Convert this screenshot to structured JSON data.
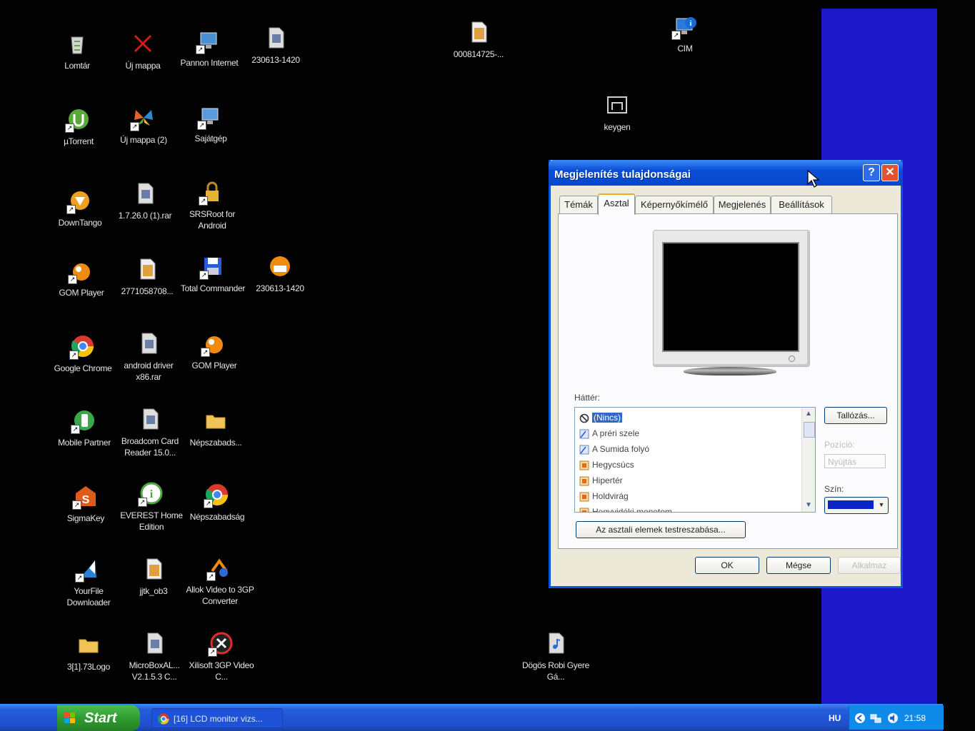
{
  "desktop": {
    "icons": [
      {
        "id": "lomtar",
        "label": "Lomtár",
        "icon": "recycle-bin-icon",
        "color": "#cfd6d8"
      },
      {
        "id": "uj-mappa",
        "label": "Új mappa",
        "icon": "red-x-icon",
        "color": "#d21b1b"
      },
      {
        "id": "pannon",
        "label": "Pannon Internet",
        "icon": "network-computer-icon",
        "color": "#4a8fd6"
      },
      {
        "id": "rar-230613",
        "label": "230613-1420",
        "icon": "archive-file-icon",
        "color": "#dedede"
      },
      {
        "id": "file-000814725",
        "label": "000814725-...",
        "icon": "image-file-icon",
        "color": "#e0a040"
      },
      {
        "id": "cim",
        "label": "CIM",
        "icon": "info-computer-icon",
        "color": "#2a7ad6"
      },
      {
        "id": "keygen",
        "label": "keygen",
        "icon": "keygen-icon",
        "color": "#cfcfcf"
      },
      {
        "id": "utorrent",
        "label": "µTorrent",
        "icon": "utorrent-icon",
        "color": "#5aa83c"
      },
      {
        "id": "uj-mappa-2",
        "label": "Új mappa (2)",
        "icon": "butterfly-icon",
        "color": "#e0632a"
      },
      {
        "id": "sajatgep",
        "label": "Sajátgép",
        "icon": "my-computer-icon",
        "color": "#5a9be0"
      },
      {
        "id": "downtango",
        "label": "DownTango",
        "icon": "downtango-icon",
        "color": "#f0a020"
      },
      {
        "id": "rar-1726",
        "label": "1.7.26.0 (1).rar",
        "icon": "archive-file-icon",
        "color": "#dedede"
      },
      {
        "id": "srsroot",
        "label": "SRSRoot for Android",
        "icon": "padlock-icon",
        "color": "#e6b230"
      },
      {
        "id": "gom1",
        "label": "GOM Player",
        "icon": "gom-player-icon",
        "color": "#f08a10"
      },
      {
        "id": "file-2771",
        "label": "2771058708...",
        "icon": "image-file-icon",
        "color": "#e0a040"
      },
      {
        "id": "total-commander",
        "label": "Total Commander",
        "icon": "floppy-disk-icon",
        "color": "#2a5bd6"
      },
      {
        "id": "avi-230613",
        "label": "230613-1420",
        "icon": "avi-file-icon",
        "color": "#f08a10"
      },
      {
        "id": "chrome1",
        "label": "Google Chrome",
        "icon": "chrome-icon",
        "color": "#d93b2b"
      },
      {
        "id": "android-driver",
        "label": "android driver x86.rar",
        "icon": "archive-file-icon",
        "color": "#dedede"
      },
      {
        "id": "gom2",
        "label": "GOM Player",
        "icon": "gom-player-icon",
        "color": "#f08a10"
      },
      {
        "id": "mobile-partner",
        "label": "Mobile Partner",
        "icon": "mobile-partner-icon",
        "color": "#3aa84a"
      },
      {
        "id": "broadcom",
        "label": "Broadcom Card Reader 15.0...",
        "icon": "archive-file-icon",
        "color": "#dedede"
      },
      {
        "id": "nepszabads",
        "label": "Népszabads...",
        "icon": "folder-icon",
        "color": "#f2c357"
      },
      {
        "id": "sigmakey",
        "label": "SigmaKey",
        "icon": "sigmakey-icon",
        "color": "#e05a1a"
      },
      {
        "id": "everest",
        "label": "EVEREST Home Edition",
        "icon": "everest-icon",
        "color": "#4aa83a"
      },
      {
        "id": "nepszabadsag-chrome",
        "label": "Népszabadság",
        "icon": "chrome-icon",
        "color": "#d93b2b"
      },
      {
        "id": "yourfile",
        "label": "YourFile Downloader",
        "icon": "yourfile-icon",
        "color": "#2a80d6"
      },
      {
        "id": "jtk-ob3",
        "label": "jjtk_ob3",
        "icon": "image-file-icon",
        "color": "#e0a040"
      },
      {
        "id": "allok",
        "label": "Allok Video to 3GP Converter",
        "icon": "allok-converter-icon",
        "color": "#f08a10"
      },
      {
        "id": "73logo",
        "label": "3[1].73Logo",
        "icon": "folder-icon",
        "color": "#f2c357"
      },
      {
        "id": "microbox",
        "label": "MicroBoxAL... V2.1.5.3 C...",
        "icon": "archive-file-icon",
        "color": "#dedede"
      },
      {
        "id": "xilisoft",
        "label": "Xilisoft 3GP Video C...",
        "icon": "xilisoft-icon",
        "color": "#d9302a"
      },
      {
        "id": "dogos",
        "label": "Dögös Robi Gyere Gá...",
        "icon": "mp3-file-icon",
        "color": "#dedede"
      }
    ]
  },
  "dialog": {
    "title": "Megjelenítés tulajdonságai",
    "help": "?",
    "close": "✕",
    "tabs": [
      {
        "label": "Témák"
      },
      {
        "label": "Asztal",
        "active": true
      },
      {
        "label": "Képernyőkímélő"
      },
      {
        "label": "Megjelenés"
      },
      {
        "label": "Beállítások"
      }
    ],
    "background_label": "Háttér:",
    "background_items": [
      {
        "label": "(Nincs)",
        "selected": true,
        "icon": "none-icon"
      },
      {
        "label": "A préri szele",
        "icon": "wallpaper-icon"
      },
      {
        "label": "A Sumida folyó",
        "icon": "wallpaper-icon"
      },
      {
        "label": "Hegycsúcs",
        "icon": "image-icon"
      },
      {
        "label": "Hipertér",
        "icon": "image-icon"
      },
      {
        "label": "Holdvirág",
        "icon": "image-icon"
      },
      {
        "label": "Hegyvidéki menetem",
        "icon": "image-icon"
      }
    ],
    "browse_label": "Tallózás...",
    "position_label": "Pozíció:",
    "position_value": "Nyújtás",
    "color_label": "Szín:",
    "color_value": "#0b24c4",
    "customize_label": "Az asztali elemek testreszabása...",
    "ok_label": "OK",
    "cancel_label": "Mégse",
    "apply_label": "Alkalmaz"
  },
  "taskbar": {
    "start_label": "Start",
    "task_label": "[16] LCD monitor vizs...",
    "language": "HU",
    "clock": "21:58"
  }
}
